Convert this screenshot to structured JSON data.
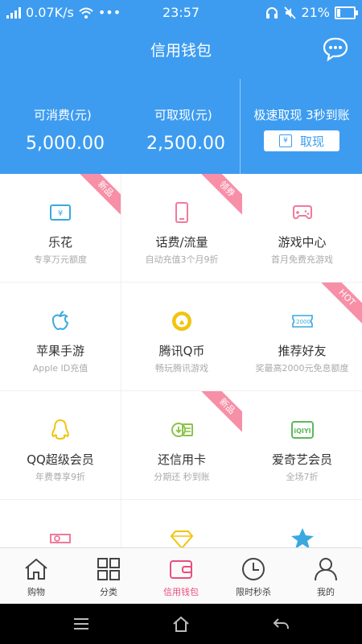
{
  "status_bar": {
    "network_speed": "0.07K/s",
    "dots": "•••",
    "time": "23:57",
    "battery": "21%",
    "icons": [
      "signal-icon",
      "wifi-icon",
      "headset-icon",
      "mute-icon",
      "battery-icon"
    ]
  },
  "header": {
    "title": "信用钱包",
    "action_icon": "chat-icon"
  },
  "wallet": {
    "consumable_label": "可消费(元)",
    "consumable_value": "5,000.00",
    "withdrawable_label": "可取现(元)",
    "withdrawable_value": "2,500.00",
    "promo_text": "极速取现 3秒到账",
    "withdraw_button": "取现",
    "withdraw_icon_glyph": "¥"
  },
  "grid": [
    {
      "title": "乐花",
      "subtitle": "专享万元额度",
      "ribbon": "新品",
      "icon": "card-icon",
      "color": "#39a9e0",
      "glyph": "¥"
    },
    {
      "title": "话费/流量",
      "subtitle": "自动充值3个月9折",
      "ribbon": "领券",
      "icon": "phone-icon",
      "color": "#f07a9c"
    },
    {
      "title": "游戏中心",
      "subtitle": "首月免费充游戏",
      "ribbon": "",
      "icon": "gamepad-icon",
      "color": "#f07a9c"
    },
    {
      "title": "苹果手游",
      "subtitle": "Apple ID充值",
      "ribbon": "",
      "icon": "apple-icon",
      "color": "#39a9e0"
    },
    {
      "title": "腾讯Q币",
      "subtitle": "畅玩腾讯游戏",
      "ribbon": "",
      "icon": "coin-icon",
      "color": "#f1c40f"
    },
    {
      "title": "推荐好友",
      "subtitle": "奖最高2000元免息额度",
      "ribbon": "HOT",
      "icon": "voucher-icon",
      "color": "#39a9e0",
      "glyph": "2000"
    },
    {
      "title": "QQ超级会员",
      "subtitle": "年费尊享9折",
      "ribbon": "",
      "icon": "penguin-icon",
      "color": "#f1c40f"
    },
    {
      "title": "还信用卡",
      "subtitle": "分期还 秒到账",
      "ribbon": "新品",
      "icon": "creditcard-icon",
      "color": "#8bc34a"
    },
    {
      "title": "爱奇艺会员",
      "subtitle": "全场7折",
      "ribbon": "",
      "icon": "iqiyi-icon",
      "color": "#5cb85c",
      "glyph": "iQIYI"
    },
    {
      "title": "",
      "subtitle": "",
      "ribbon": "",
      "icon": "ticket-icon",
      "color": "#f07a9c"
    },
    {
      "title": "",
      "subtitle": "",
      "ribbon": "",
      "icon": "diamond-icon",
      "color": "#f1c40f"
    },
    {
      "title": "",
      "subtitle": "",
      "ribbon": "",
      "icon": "star-icon",
      "color": "#39a9e0"
    }
  ],
  "tabs": [
    {
      "label": "购物",
      "icon": "home-icon",
      "active": false
    },
    {
      "label": "分类",
      "icon": "category-icon",
      "active": false
    },
    {
      "label": "信用钱包",
      "icon": "wallet-icon",
      "active": true
    },
    {
      "label": "限时秒杀",
      "icon": "clock-icon",
      "active": false
    },
    {
      "label": "我的",
      "icon": "user-icon",
      "active": false
    }
  ],
  "colors": {
    "primary": "#3d9cf0",
    "accent": "#e84f7d",
    "ribbon": "#f78fa7"
  }
}
